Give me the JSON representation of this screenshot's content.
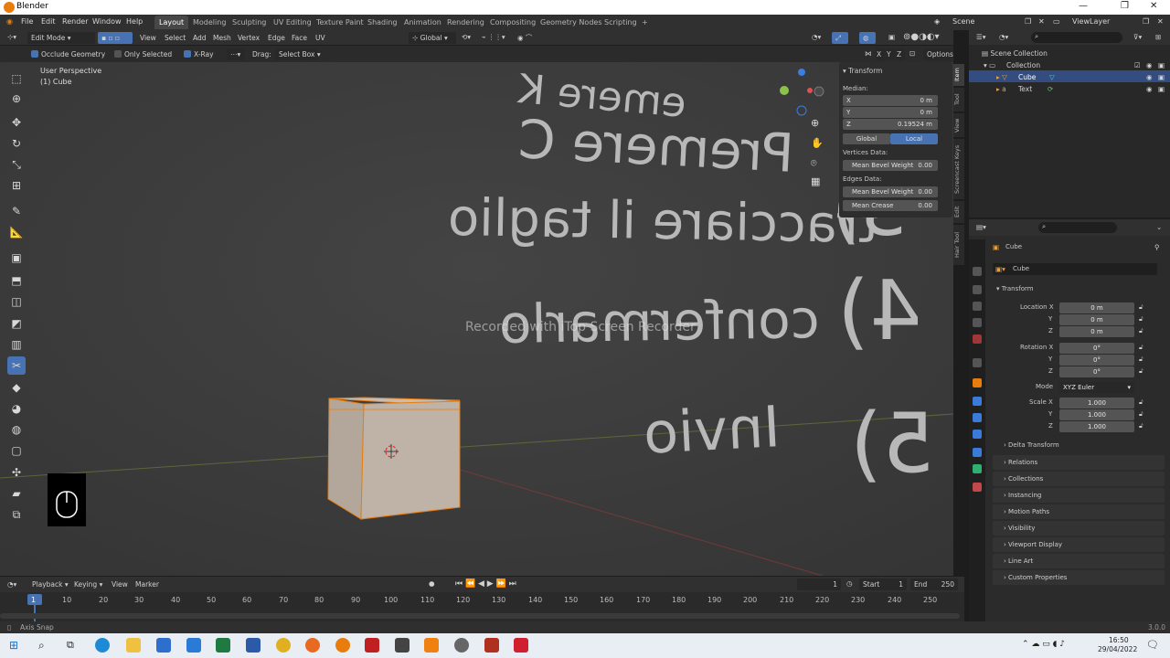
{
  "window": {
    "app_title": "Blender"
  },
  "menubar": {
    "menus": [
      "File",
      "Edit",
      "Render",
      "Window",
      "Help"
    ],
    "workspaces": [
      "Layout",
      "Modeling",
      "Sculpting",
      "UV Editing",
      "Texture Paint",
      "Shading",
      "Animation",
      "Rendering",
      "Compositing",
      "Geometry Nodes",
      "Scripting"
    ],
    "add_tab": "+",
    "scene": "Scene",
    "view_layer": "ViewLayer"
  },
  "viewport_header": {
    "mode": "Edit Mode",
    "menus": [
      "View",
      "Select",
      "Add",
      "Mesh",
      "Vertex",
      "Edge",
      "Face",
      "UV"
    ],
    "orientation": "Global"
  },
  "tool_settings": {
    "occlude_geometry": "Occlude Geometry",
    "only_selected": "Only Selected",
    "xray": "X-Ray",
    "drag_label": "Drag:",
    "drag_value": "Select Box",
    "options": "Options",
    "axes": [
      "X",
      "Y",
      "Z"
    ]
  },
  "viewport": {
    "view_name": "User Perspective",
    "object_name": "(1) Cube",
    "watermark": "Recorded with iTop Screen Recorder",
    "mirrored_text": [
      "emere K",
      "Premere C",
      "tracciare il taglio",
      "confermarlo",
      "Invio"
    ],
    "numbers": [
      "3)",
      "4)",
      "5)"
    ]
  },
  "npanel": {
    "header": "Transform",
    "median_label": "Median:",
    "median": [
      {
        "axis": "X",
        "value": "0 m"
      },
      {
        "axis": "Y",
        "value": "0 m"
      },
      {
        "axis": "Z",
        "value": "0.19524 m"
      }
    ],
    "global_label": "Global",
    "local_label": "Local",
    "vertices_data": "Vertices Data:",
    "mean_bevel_weight_v": {
      "label": "Mean Bevel Weight",
      "value": "0.00"
    },
    "edges_data": "Edges Data:",
    "mean_bevel_weight_e": {
      "label": "Mean Bevel Weight",
      "value": "0.00"
    },
    "mean_crease": {
      "label": "Mean Crease",
      "value": "0.00"
    },
    "side_tabs": [
      "Item",
      "Tool",
      "View",
      "Screencast Keys",
      "Edit",
      "Hair Tool"
    ]
  },
  "outliner": {
    "scene_collection": "Scene Collection",
    "items": [
      {
        "label": "Collection",
        "indent": 1
      },
      {
        "label": "Cube",
        "indent": 2,
        "selected": true
      },
      {
        "label": "Text",
        "indent": 2
      }
    ]
  },
  "properties": {
    "breadcrumb": "Cube",
    "object_name": "Cube",
    "transform_header": "Transform",
    "location_label": "Location X",
    "location": [
      "0 m",
      "0 m",
      "0 m"
    ],
    "rotation_label": "Rotation X",
    "rotation": [
      "0°",
      "0°",
      "0°"
    ],
    "mode_label": "Mode",
    "mode_value": "XYZ Euler",
    "scale_label": "Scale X",
    "scale": [
      "1.000",
      "1.000",
      "1.000"
    ],
    "y_label": "Y",
    "z_label": "Z",
    "delta_transform": "Delta Transform",
    "sections": [
      "Relations",
      "Collections",
      "Instancing",
      "Motion Paths",
      "Visibility",
      "Viewport Display",
      "Line Art",
      "Custom Properties"
    ]
  },
  "timeline": {
    "menus": [
      "Playback",
      "Keying",
      "View",
      "Marker"
    ],
    "current_frame": "1",
    "start_label": "Start",
    "start": "1",
    "end_label": "End",
    "end": "250",
    "ticks": [
      "1",
      "10",
      "20",
      "30",
      "40",
      "50",
      "60",
      "70",
      "80",
      "90",
      "100",
      "110",
      "120",
      "130",
      "140",
      "150",
      "160",
      "170",
      "180",
      "190",
      "200",
      "210",
      "220",
      "230",
      "240",
      "250"
    ]
  },
  "statusbar": {
    "left": "Axis Snap",
    "version": "3.0.0"
  },
  "taskbar": {
    "time": "16:50",
    "date": "29/04/2022"
  },
  "colors": {
    "accent": "#4772b3",
    "selection": "#e87d0d",
    "viewport": "#3c3c3c"
  }
}
